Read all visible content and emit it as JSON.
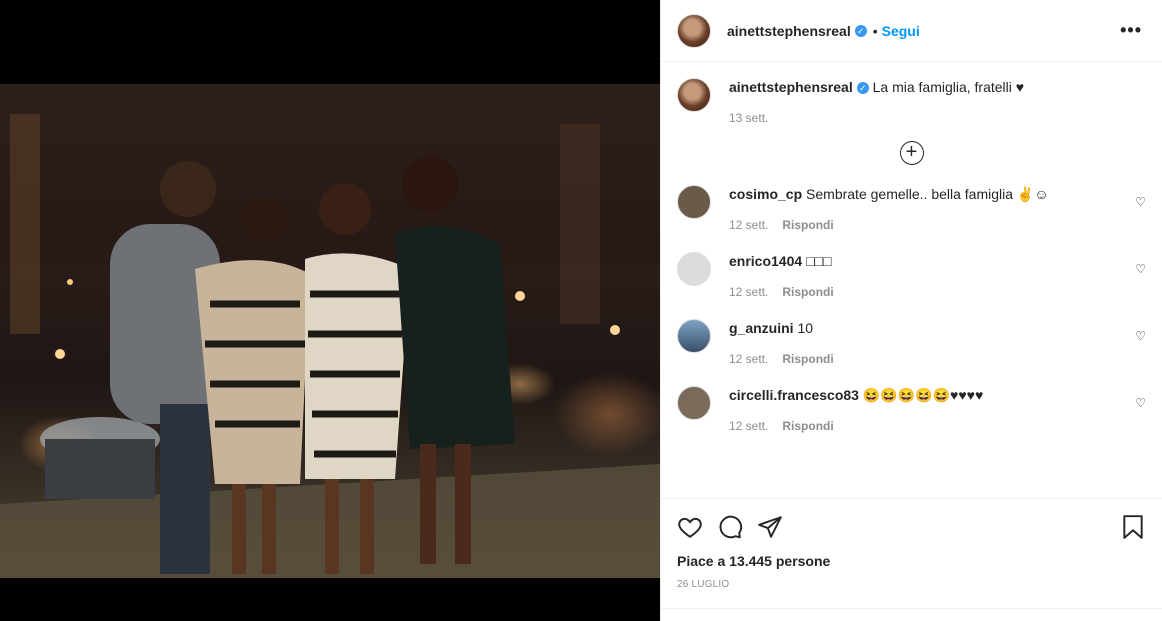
{
  "post": {
    "username": "ainettstephensreal",
    "follow_label": "Segui",
    "more_label": "•••",
    "caption_text": "La mia famiglia, fratelli ♥",
    "caption_time": "13 sett.",
    "load_more_symbol": "+",
    "likes_text": "Piace a 13.445 persone",
    "date_text": "26 LUGLIO"
  },
  "comments": [
    {
      "user": "cosimo_cp",
      "text": "Sembrate gemelle.. bella famiglia ✌☺",
      "time": "12 sett.",
      "reply": "Rispondi",
      "avatar": "#6b5a4a"
    },
    {
      "user": "enrico1404",
      "text": "□□□",
      "time": "12 sett.",
      "reply": "Rispondi",
      "avatar": "#dcdcdc"
    },
    {
      "user": "g_anzuini",
      "text": "10",
      "time": "12 sett.",
      "reply": "Rispondi",
      "avatar": "#6a8bb3"
    },
    {
      "user": "circelli.francesco83",
      "text": "😆😆😆😆😆♥♥♥♥",
      "time": "12 sett.",
      "reply": "Rispondi",
      "avatar": "#7a6a5a"
    }
  ],
  "icons": {
    "verified": "verified-badge-icon",
    "like": "heart-icon",
    "comment": "comment-icon",
    "share": "paper-plane-icon",
    "save": "bookmark-icon",
    "more": "more-options-icon"
  },
  "colors": {
    "link": "#0095f6",
    "verified": "#3897f0",
    "text": "#262626",
    "muted": "#8e8e8e"
  }
}
